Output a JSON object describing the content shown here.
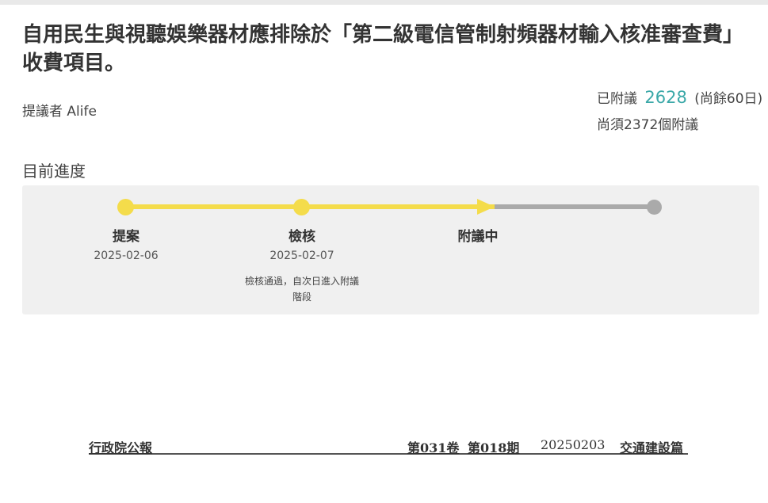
{
  "title": "自用民生與視聽娛樂器材應排除於「第二級電信管制射頻器材輸入核准審查費」收費項目。",
  "proposer": "提議者 Alife",
  "stats": {
    "attached_label": "已附議",
    "attached_count": "2628",
    "remaining_days": "(尚餘60日)",
    "needed": "尚須2372個附議"
  },
  "progress": {
    "heading": "目前進度",
    "steps": [
      {
        "name": "提案",
        "date": "2025-02-06",
        "note": ""
      },
      {
        "name": "檢核",
        "date": "2025-02-07",
        "note": "檢核通過，自次日進入附議階段"
      },
      {
        "name": "附議中",
        "date": "",
        "note": ""
      }
    ],
    "colors": {
      "done": "#f4dc4b",
      "pending": "#aaaaaa"
    }
  },
  "gazette": {
    "publisher": "行政院公報",
    "volume": "第031卷",
    "issue": "第018期",
    "date": "20250203",
    "section": "交通建設篇"
  }
}
